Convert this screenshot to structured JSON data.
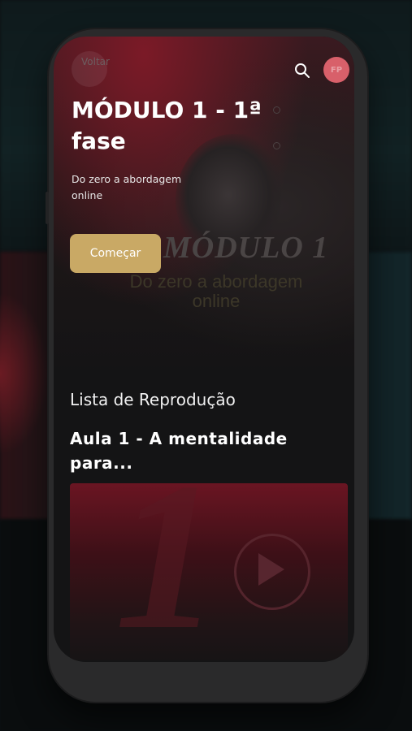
{
  "header": {
    "back_label": "Voltar",
    "avatar_initials": "FP"
  },
  "hero": {
    "title": "MÓDULO 1 - 1ª fase",
    "description": "Do zero a abordagem online",
    "start_label": "Começar",
    "art_title": "MÓDULO 1",
    "art_subtitle": "Do zero a abordagem online"
  },
  "playlist": {
    "section_title": "Lista de Reprodução",
    "items": [
      {
        "title": "Aula 1 - A mentalidade para..."
      }
    ]
  },
  "icons": {
    "search": "search-icon",
    "play": "play-icon"
  },
  "colors": {
    "accent": "#c9a965",
    "avatar_bg": "#d8606a",
    "screen_bg": "#141415"
  }
}
